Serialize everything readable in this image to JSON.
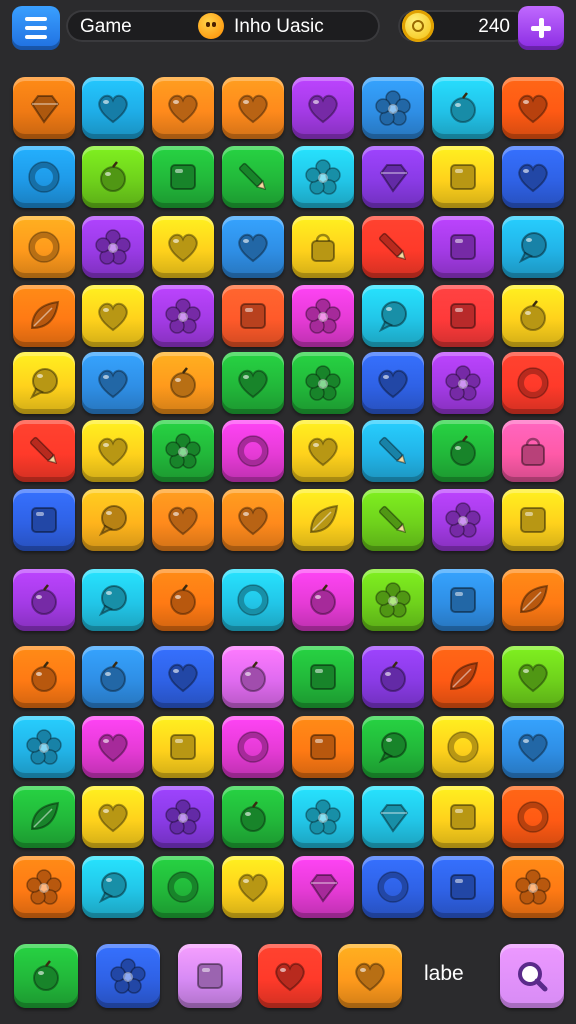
{
  "header": {
    "game_label": "Game",
    "title": "Inho Uasic",
    "coins": "240",
    "icons": {
      "menu": "hamburger-menu-icon",
      "title": "face-badge-icon",
      "coin": "coin-icon",
      "add": "plus-icon"
    },
    "colors": {
      "menu": "#2a86f0",
      "add": "#a040f0",
      "coin": "#f5c400"
    }
  },
  "board": {
    "rows": [
      [
        [
          "#f07a14",
          "gem"
        ],
        [
          "#1faee8",
          "heart"
        ],
        [
          "#ff8a1c",
          "heart"
        ],
        [
          "#ff8a1c",
          "heart"
        ],
        [
          "#a43be6",
          "heart"
        ],
        [
          "#2f8fe6",
          "flower"
        ],
        [
          "#22c2e8",
          "apple"
        ],
        [
          "#ff5a14",
          "heart"
        ]
      ],
      [
        [
          "#1f9ae8",
          "ring"
        ],
        [
          "#6fd21c",
          "apple"
        ],
        [
          "#22b83a",
          "square"
        ],
        [
          "#22b83a",
          "pencil"
        ],
        [
          "#22c6e8",
          "flower"
        ],
        [
          "#8a3be6",
          "gem"
        ],
        [
          "#ffd21c",
          "square"
        ],
        [
          "#2f62e6",
          "heart"
        ]
      ],
      [
        [
          "#ff9a1c",
          "ring"
        ],
        [
          "#9a3be6",
          "flower"
        ],
        [
          "#ffd21c",
          "heart"
        ],
        [
          "#2f8fe6",
          "heart"
        ],
        [
          "#ffd21c",
          "bag"
        ],
        [
          "#ff3a2a",
          "pencil"
        ],
        [
          "#a43be6",
          "square"
        ],
        [
          "#22b4e8",
          "bubble"
        ]
      ],
      [
        [
          "#ff7a14",
          "leaf"
        ],
        [
          "#ffd21c",
          "heart"
        ],
        [
          "#a43be6",
          "flower"
        ],
        [
          "#ff5a2a",
          "square"
        ],
        [
          "#e63bd6",
          "flower"
        ],
        [
          "#22c6e8",
          "bubble"
        ],
        [
          "#ff3a3a",
          "square"
        ],
        [
          "#ffd21c",
          "apple"
        ]
      ],
      [
        [
          "#ffd21c",
          "bubble"
        ],
        [
          "#2f8fe6",
          "heart"
        ],
        [
          "#ff9a1c",
          "apple"
        ],
        [
          "#22b83a",
          "heart"
        ],
        [
          "#22b83a",
          "flower"
        ],
        [
          "#2f62e6",
          "heart"
        ],
        [
          "#a43be6",
          "flower"
        ],
        [
          "#ff3a2a",
          "ring"
        ]
      ],
      [
        [
          "#ff3a2a",
          "pencil"
        ],
        [
          "#ffd21c",
          "heart"
        ],
        [
          "#22b83a",
          "flower"
        ],
        [
          "#e63bd6",
          "ring"
        ],
        [
          "#ffd21c",
          "heart"
        ],
        [
          "#22b4e8",
          "pencil"
        ],
        [
          "#22b83a",
          "apple"
        ],
        [
          "#ff5aa8",
          "bag"
        ]
      ],
      [
        [
          "#2f62e6",
          "square"
        ],
        [
          "#ffb41c",
          "bubble"
        ],
        [
          "#ff8a1c",
          "heart"
        ],
        [
          "#ff8a1c",
          "heart"
        ],
        [
          "#ffd21c",
          "leaf"
        ],
        [
          "#6fd21c",
          "pencil"
        ],
        [
          "#a43be6",
          "flower"
        ],
        [
          "#ffd21c",
          "square"
        ]
      ],
      [
        [
          "#a43be6",
          "apple"
        ],
        [
          "#22c6e8",
          "bubble"
        ],
        [
          "#ff7a14",
          "apple"
        ],
        [
          "#22c6e8",
          "ring"
        ],
        [
          "#e63bd6",
          "apple"
        ],
        [
          "#6fd21c",
          "flower"
        ],
        [
          "#2f8fe6",
          "square"
        ],
        [
          "#ff7a14",
          "leaf"
        ]
      ],
      [
        [
          "#ff7a14",
          "apple"
        ],
        [
          "#2f8fe6",
          "apple"
        ],
        [
          "#2f62e6",
          "heart"
        ],
        [
          "#e06bf0",
          "apple"
        ],
        [
          "#22b83a",
          "square"
        ],
        [
          "#8a3be6",
          "apple"
        ],
        [
          "#ff5a14",
          "leaf"
        ],
        [
          "#6fd21c",
          "heart"
        ]
      ],
      [
        [
          "#22b4e8",
          "flower"
        ],
        [
          "#e63bd6",
          "heart"
        ],
        [
          "#ffd21c",
          "square"
        ],
        [
          "#e63bd6",
          "ring"
        ],
        [
          "#ff7a14",
          "square"
        ],
        [
          "#22b83a",
          "bubble"
        ],
        [
          "#ffd21c",
          "ring"
        ],
        [
          "#2f8fe6",
          "heart"
        ]
      ],
      [
        [
          "#22b83a",
          "leaf"
        ],
        [
          "#ffd21c",
          "heart"
        ],
        [
          "#8a3be6",
          "flower"
        ],
        [
          "#22b83a",
          "apple"
        ],
        [
          "#22c6e8",
          "flower"
        ],
        [
          "#22c6e8",
          "gem"
        ],
        [
          "#ffd21c",
          "square"
        ],
        [
          "#ff5a14",
          "ring"
        ]
      ],
      [
        [
          "#ff7a14",
          "flower"
        ],
        [
          "#22c6e8",
          "bubble"
        ],
        [
          "#22b83a",
          "ring"
        ],
        [
          "#ffd21c",
          "heart"
        ],
        [
          "#e63bd6",
          "gem"
        ],
        [
          "#2f62e6",
          "ring"
        ],
        [
          "#2f62e6",
          "square"
        ],
        [
          "#ff7a14",
          "flower"
        ]
      ]
    ]
  },
  "tray": {
    "items": [
      [
        "#22b83a",
        "apple"
      ],
      [
        "#2f62e6",
        "flower"
      ],
      [
        "#d78bf5",
        "square"
      ],
      [
        "#ff3a2a",
        "heart"
      ],
      [
        "#ff9a1c",
        "heart"
      ]
    ],
    "label": "labe",
    "search_icon": "magnifier-icon",
    "search_color": "#d78bf5"
  }
}
